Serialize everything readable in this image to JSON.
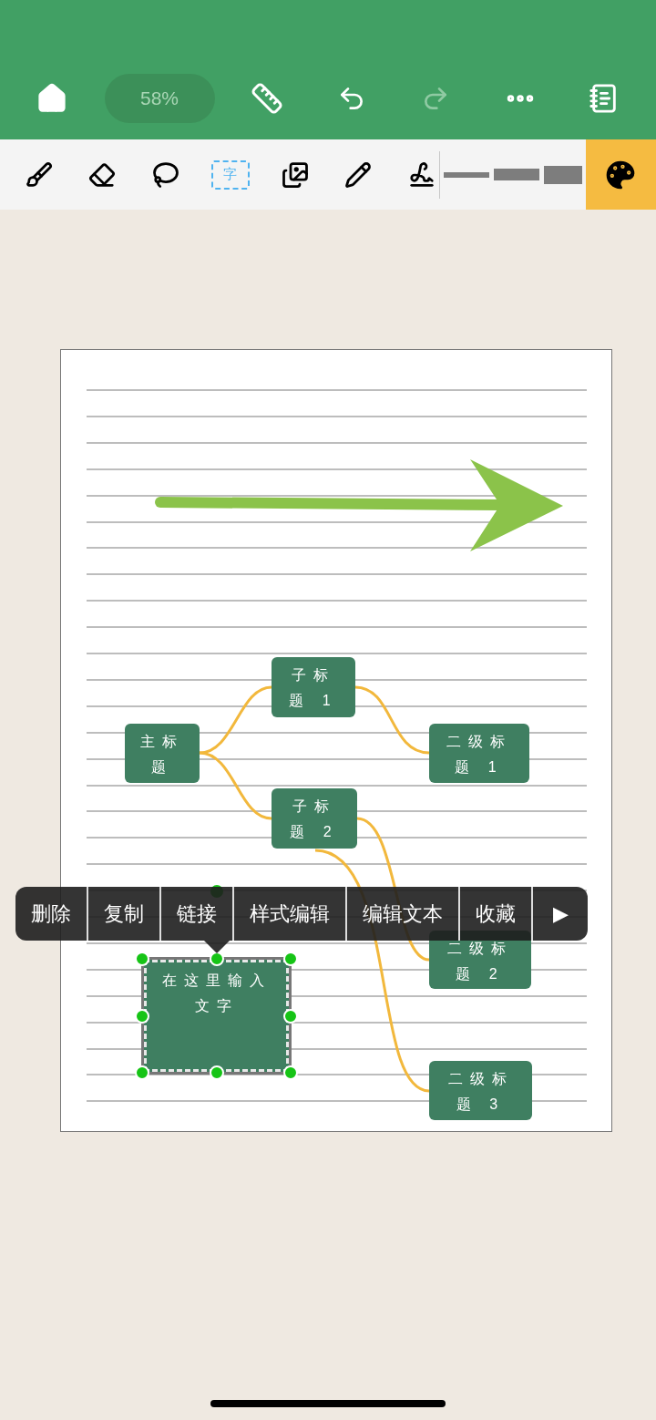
{
  "top_bar": {
    "zoom": "58%",
    "redo_disabled": true
  },
  "tools": [
    {
      "kind": "brush",
      "selected": false
    },
    {
      "kind": "eraser",
      "selected": false
    },
    {
      "kind": "lasso",
      "selected": false
    },
    {
      "kind": "text",
      "label": "字",
      "selected": true
    },
    {
      "kind": "image",
      "selected": false
    },
    {
      "kind": "pencil",
      "selected": false
    },
    {
      "kind": "signature",
      "selected": false
    }
  ],
  "mind_map": {
    "nodes": [
      {
        "text": "主标题",
        "selected": false
      },
      {
        "text": "子标题 1",
        "selected": false
      },
      {
        "text": "子标题 2",
        "selected": false
      },
      {
        "text": "二级标题 1",
        "selected": false
      },
      {
        "text": "二级标题 2",
        "selected": false
      },
      {
        "text": "二级标题 3",
        "selected": false
      },
      {
        "text": "在这里输入文字",
        "selected": true
      }
    ]
  },
  "context_menu": [
    "删除",
    "复制",
    "链接",
    "样式编辑",
    "编辑文本",
    "收藏",
    "▶"
  ]
}
